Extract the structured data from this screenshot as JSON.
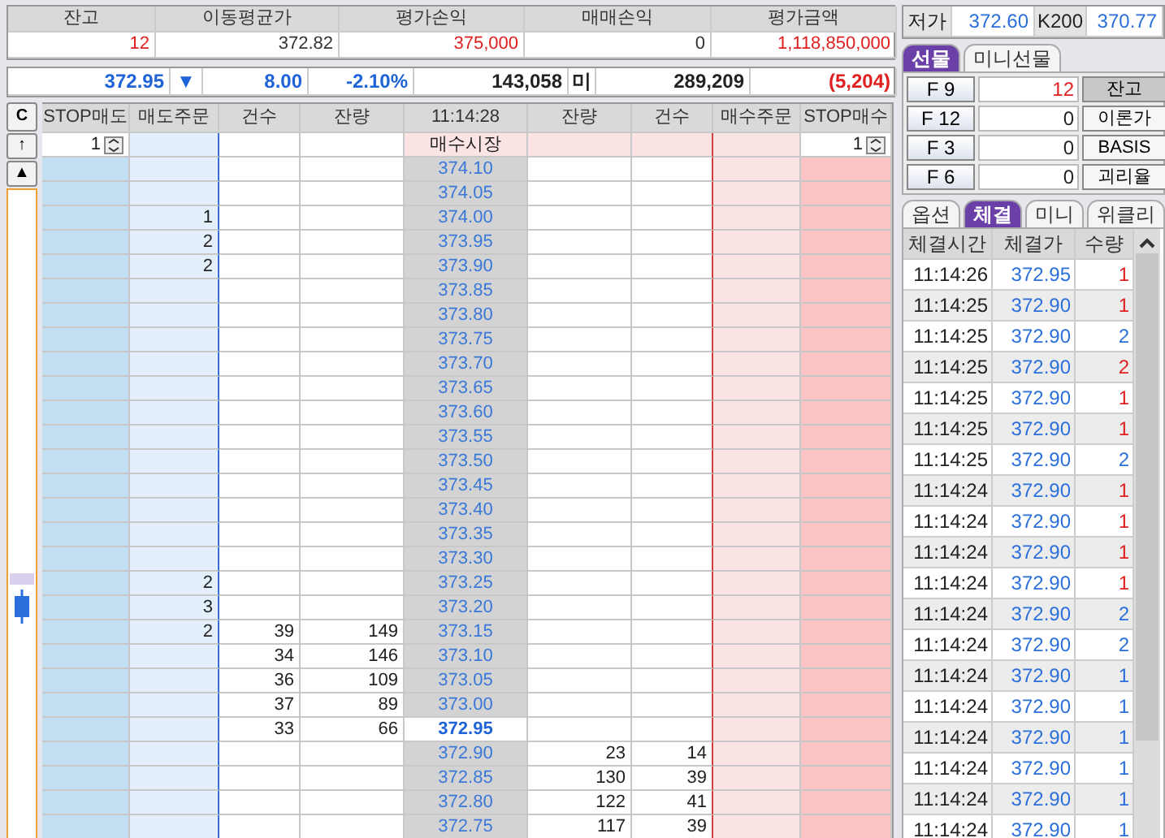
{
  "position_table": {
    "columns": [
      "잔고",
      "이동평균가",
      "평가손익",
      "매매손익",
      "평가금액"
    ],
    "values": [
      {
        "text": "12",
        "color": "#e02020"
      },
      {
        "text": "372.82",
        "color": "#333333"
      },
      {
        "text": "375,000",
        "color": "#e02020"
      },
      {
        "text": "0",
        "color": "#333333"
      },
      {
        "text": "1,118,850,000",
        "color": "#e02020"
      }
    ]
  },
  "quote_bar": {
    "price": "372.95",
    "direction": "▼",
    "change": "8.00",
    "change_rate": "-2.10%",
    "volume": "143,058",
    "oi_label": "미",
    "open_interest": "289,209",
    "oi_change": "(5,204)"
  },
  "ladder": {
    "clear_button": "C",
    "up_button": "↑",
    "top_button": "▲",
    "columns": [
      "STOP매도",
      "매도주문",
      "건수",
      "잔량",
      "11:14:28",
      "잔량",
      "건수",
      "매수주문",
      "STOP매수"
    ],
    "stop_sell_qty": "1",
    "market_label": "매수시장",
    "stop_buy_qty": "1",
    "rows": [
      {
        "price": "374.10",
        "current": false
      },
      {
        "price": "374.05",
        "current": false
      },
      {
        "price": "374.00",
        "sell_order": "1",
        "current": false
      },
      {
        "price": "373.95",
        "sell_order": "2",
        "current": false
      },
      {
        "price": "373.90",
        "sell_order": "2",
        "current": false
      },
      {
        "price": "373.85",
        "current": false
      },
      {
        "price": "373.80",
        "current": false
      },
      {
        "price": "373.75",
        "current": false
      },
      {
        "price": "373.70",
        "current": false
      },
      {
        "price": "373.65",
        "current": false
      },
      {
        "price": "373.60",
        "current": false
      },
      {
        "price": "373.55",
        "current": false
      },
      {
        "price": "373.50",
        "current": false
      },
      {
        "price": "373.45",
        "current": false
      },
      {
        "price": "373.40",
        "current": false
      },
      {
        "price": "373.35",
        "current": false
      },
      {
        "price": "373.30",
        "current": false
      },
      {
        "price": "373.25",
        "sell_order": "2",
        "current": false
      },
      {
        "price": "373.20",
        "sell_order": "3",
        "current": false
      },
      {
        "price": "373.15",
        "sell_order": "2",
        "sell_count": "39",
        "sell_qty": "149",
        "current": false
      },
      {
        "price": "373.10",
        "sell_count": "34",
        "sell_qty": "146",
        "current": false
      },
      {
        "price": "373.05",
        "sell_count": "36",
        "sell_qty": "109",
        "current": false
      },
      {
        "price": "373.00",
        "sell_count": "37",
        "sell_qty": "89",
        "current": false
      },
      {
        "price": "372.95",
        "sell_count": "33",
        "sell_qty": "66",
        "current": true
      },
      {
        "price": "372.90",
        "buy_qty": "23",
        "buy_count": "14",
        "current": false
      },
      {
        "price": "372.85",
        "buy_qty": "130",
        "buy_count": "39",
        "current": false
      },
      {
        "price": "372.80",
        "buy_qty": "122",
        "buy_count": "41",
        "current": false
      },
      {
        "price": "372.75",
        "buy_qty": "117",
        "buy_count": "39",
        "current": false
      }
    ]
  },
  "quote_info": [
    {
      "label": "저가",
      "value": "372.60"
    },
    {
      "label": "K200",
      "value": "370.77"
    }
  ],
  "product_tabs": [
    {
      "label": "선물",
      "selected": true
    },
    {
      "label": "미니선물",
      "selected": false
    }
  ],
  "contracts": [
    {
      "label": "F 9",
      "qty": "12",
      "color": "#e02020"
    },
    {
      "label": "F 12",
      "qty": "0",
      "color": "#222222"
    },
    {
      "label": "F 3",
      "qty": "0",
      "color": "#222222"
    },
    {
      "label": "F 6",
      "qty": "0",
      "color": "#222222"
    }
  ],
  "side_buttons": [
    {
      "label": "잔고",
      "pressed": true
    },
    {
      "label": "이론가",
      "pressed": false
    },
    {
      "label": "BASIS",
      "pressed": false
    },
    {
      "label": "괴리율",
      "pressed": false
    }
  ],
  "trade_tabs": [
    {
      "label": "옵션",
      "selected": false
    },
    {
      "label": "체결",
      "selected": true
    },
    {
      "label": "미니",
      "selected": false
    },
    {
      "label": "위클리",
      "selected": false
    }
  ],
  "trades": {
    "columns": [
      "체결시간",
      "체결가",
      "수량"
    ],
    "rows": [
      {
        "time": "11:14:26",
        "price": "372.95",
        "qty": "1",
        "color": "#e02020"
      },
      {
        "time": "11:14:25",
        "price": "372.90",
        "qty": "1",
        "color": "#e02020"
      },
      {
        "time": "11:14:25",
        "price": "372.90",
        "qty": "2",
        "color": "#2a6fdb"
      },
      {
        "time": "11:14:25",
        "price": "372.90",
        "qty": "2",
        "color": "#e02020"
      },
      {
        "time": "11:14:25",
        "price": "372.90",
        "qty": "1",
        "color": "#e02020"
      },
      {
        "time": "11:14:25",
        "price": "372.90",
        "qty": "1",
        "color": "#e02020"
      },
      {
        "time": "11:14:25",
        "price": "372.90",
        "qty": "2",
        "color": "#2a6fdb"
      },
      {
        "time": "11:14:24",
        "price": "372.90",
        "qty": "1",
        "color": "#e02020"
      },
      {
        "time": "11:14:24",
        "price": "372.90",
        "qty": "1",
        "color": "#e02020"
      },
      {
        "time": "11:14:24",
        "price": "372.90",
        "qty": "1",
        "color": "#e02020"
      },
      {
        "time": "11:14:24",
        "price": "372.90",
        "qty": "1",
        "color": "#e02020"
      },
      {
        "time": "11:14:24",
        "price": "372.90",
        "qty": "2",
        "color": "#2a6fdb"
      },
      {
        "time": "11:14:24",
        "price": "372.90",
        "qty": "2",
        "color": "#2a6fdb"
      },
      {
        "time": "11:14:24",
        "price": "372.90",
        "qty": "1",
        "color": "#2a6fdb"
      },
      {
        "time": "11:14:24",
        "price": "372.90",
        "qty": "1",
        "color": "#2a6fdb"
      },
      {
        "time": "11:14:24",
        "price": "372.90",
        "qty": "1",
        "color": "#2a6fdb"
      },
      {
        "time": "11:14:24",
        "price": "372.90",
        "qty": "1",
        "color": "#2a6fdb"
      },
      {
        "time": "11:14:24",
        "price": "372.90",
        "qty": "1",
        "color": "#2a6fdb"
      },
      {
        "time": "11:14:24",
        "price": "372.90",
        "qty": "1",
        "color": "#2a6fdb"
      }
    ]
  }
}
